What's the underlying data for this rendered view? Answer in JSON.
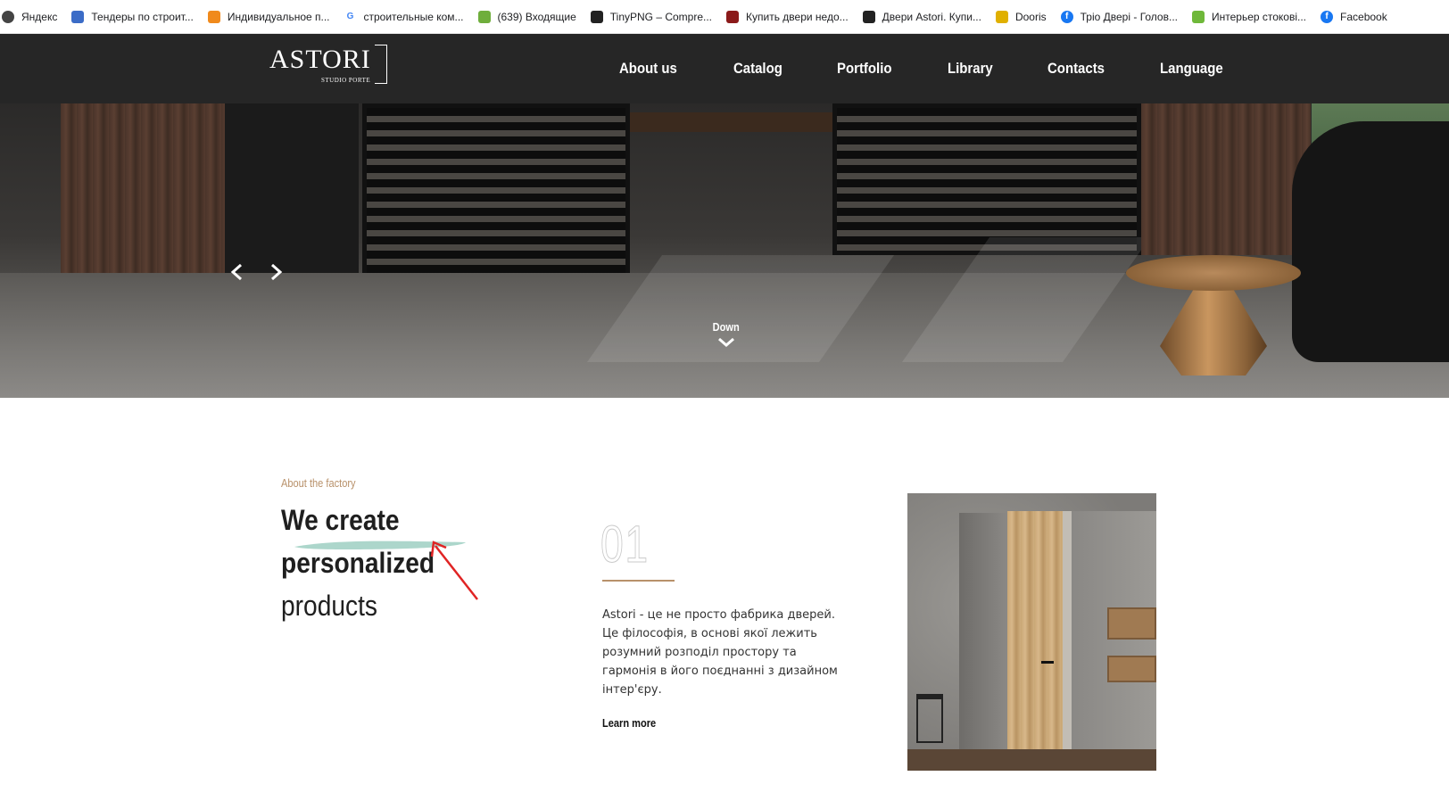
{
  "bookmarks": [
    {
      "label": "Яндекс",
      "icon": "yandex-icon",
      "color": "#444444"
    },
    {
      "label": "Тендеры по строит...",
      "icon": "tender-icon",
      "color": "#3b6cc7"
    },
    {
      "label": "Индивидуальное п...",
      "icon": "cloud-icon",
      "color": "#f08a1c"
    },
    {
      "label": "строительные ком...",
      "icon": "google-icon",
      "color": "#4285f4"
    },
    {
      "label": "(639) Входящие",
      "icon": "mail-icon",
      "color": "#6fae3c"
    },
    {
      "label": "TinyPNG – Compre...",
      "icon": "panda-icon",
      "color": "#222222"
    },
    {
      "label": "Купить двери недо...",
      "icon": "door-icon",
      "color": "#8b1a1a"
    },
    {
      "label": "Двери Astori. Купи...",
      "icon": "astori-icon",
      "color": "#222222"
    },
    {
      "label": "Dooris",
      "icon": "dooris-icon",
      "color": "#e0b000"
    },
    {
      "label": "Тріо Двері - Голов...",
      "icon": "facebook-icon",
      "color": "#1877f2"
    },
    {
      "label": "Интерьер стокові...",
      "icon": "interior-icon",
      "color": "#6fb83a"
    },
    {
      "label": "Facebook",
      "icon": "facebook-icon",
      "color": "#1877f2"
    }
  ],
  "header": {
    "logo_main": "ASTORI",
    "logo_sub": "STUDIO PORTE",
    "nav": [
      "About us",
      "Catalog",
      "Portfolio",
      "Library",
      "Contacts",
      "Language"
    ]
  },
  "hero": {
    "down_label": "Down"
  },
  "about": {
    "eyebrow": "About the factory",
    "title_line1": "We create personalized",
    "title_line2": "products",
    "number": "01",
    "description": "Astori - це не просто фабрика дверей. Це філософія, в основі якої лежить розумний розподіл простору та гармонія в його поєднанні з дизайном інтер'єру.",
    "learn_more": "Learn more"
  },
  "colors": {
    "accent": "#b8916a",
    "header_bg": "#262626",
    "brush": "#9ecfc2",
    "annotation_arrow": "#e02424"
  }
}
